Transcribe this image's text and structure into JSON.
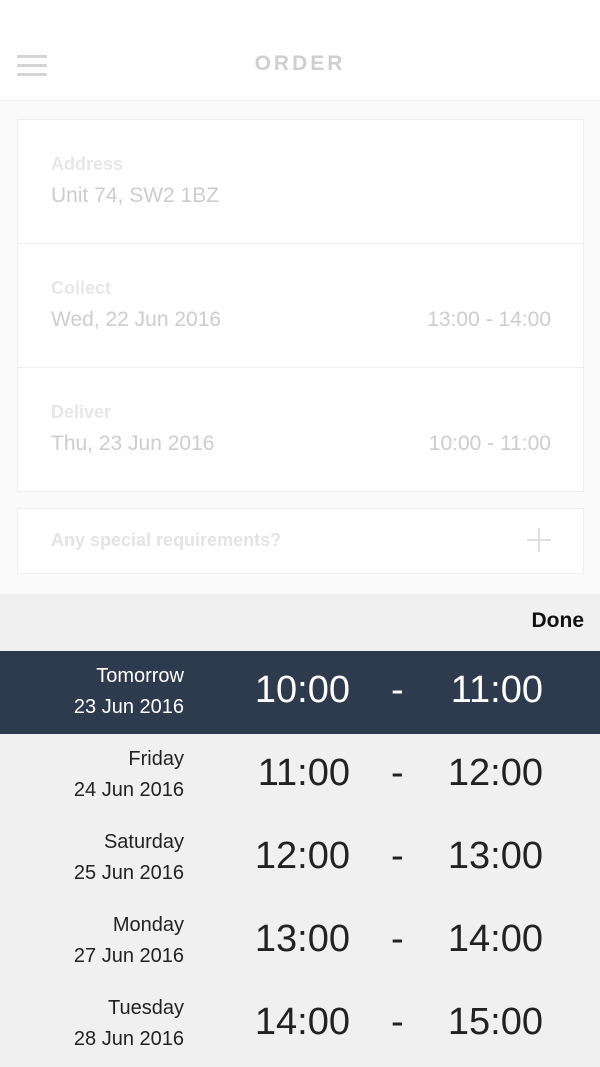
{
  "header": {
    "title": "ORDER",
    "menu_icon": "hamburger-menu-icon"
  },
  "order": {
    "address": {
      "label": "Address",
      "value": "Unit 74, SW2 1BZ"
    },
    "collect": {
      "label": "Collect",
      "date": "Wed, 22 Jun 2016",
      "time": "13:00 - 14:00"
    },
    "deliver": {
      "label": "Deliver",
      "date": "Thu, 23 Jun 2016",
      "time": "10:00 - 11:00"
    },
    "requirements": {
      "placeholder": "Any special requirements?",
      "icon": "plus-icon"
    }
  },
  "picker": {
    "done_label": "Done",
    "separator": "-",
    "selected_color": "#2e3a4d",
    "slots": [
      {
        "day": "Tomorrow",
        "date": "23 Jun 2016",
        "start": "10:00",
        "end": "11:00",
        "selected": true
      },
      {
        "day": "Friday",
        "date": "24 Jun 2016",
        "start": "11:00",
        "end": "12:00",
        "selected": false
      },
      {
        "day": "Saturday",
        "date": "25 Jun 2016",
        "start": "12:00",
        "end": "13:00",
        "selected": false
      },
      {
        "day": "Monday",
        "date": "27 Jun 2016",
        "start": "13:00",
        "end": "14:00",
        "selected": false
      },
      {
        "day": "Tuesday",
        "date": "28 Jun 2016",
        "start": "14:00",
        "end": "15:00",
        "selected": false
      }
    ]
  }
}
